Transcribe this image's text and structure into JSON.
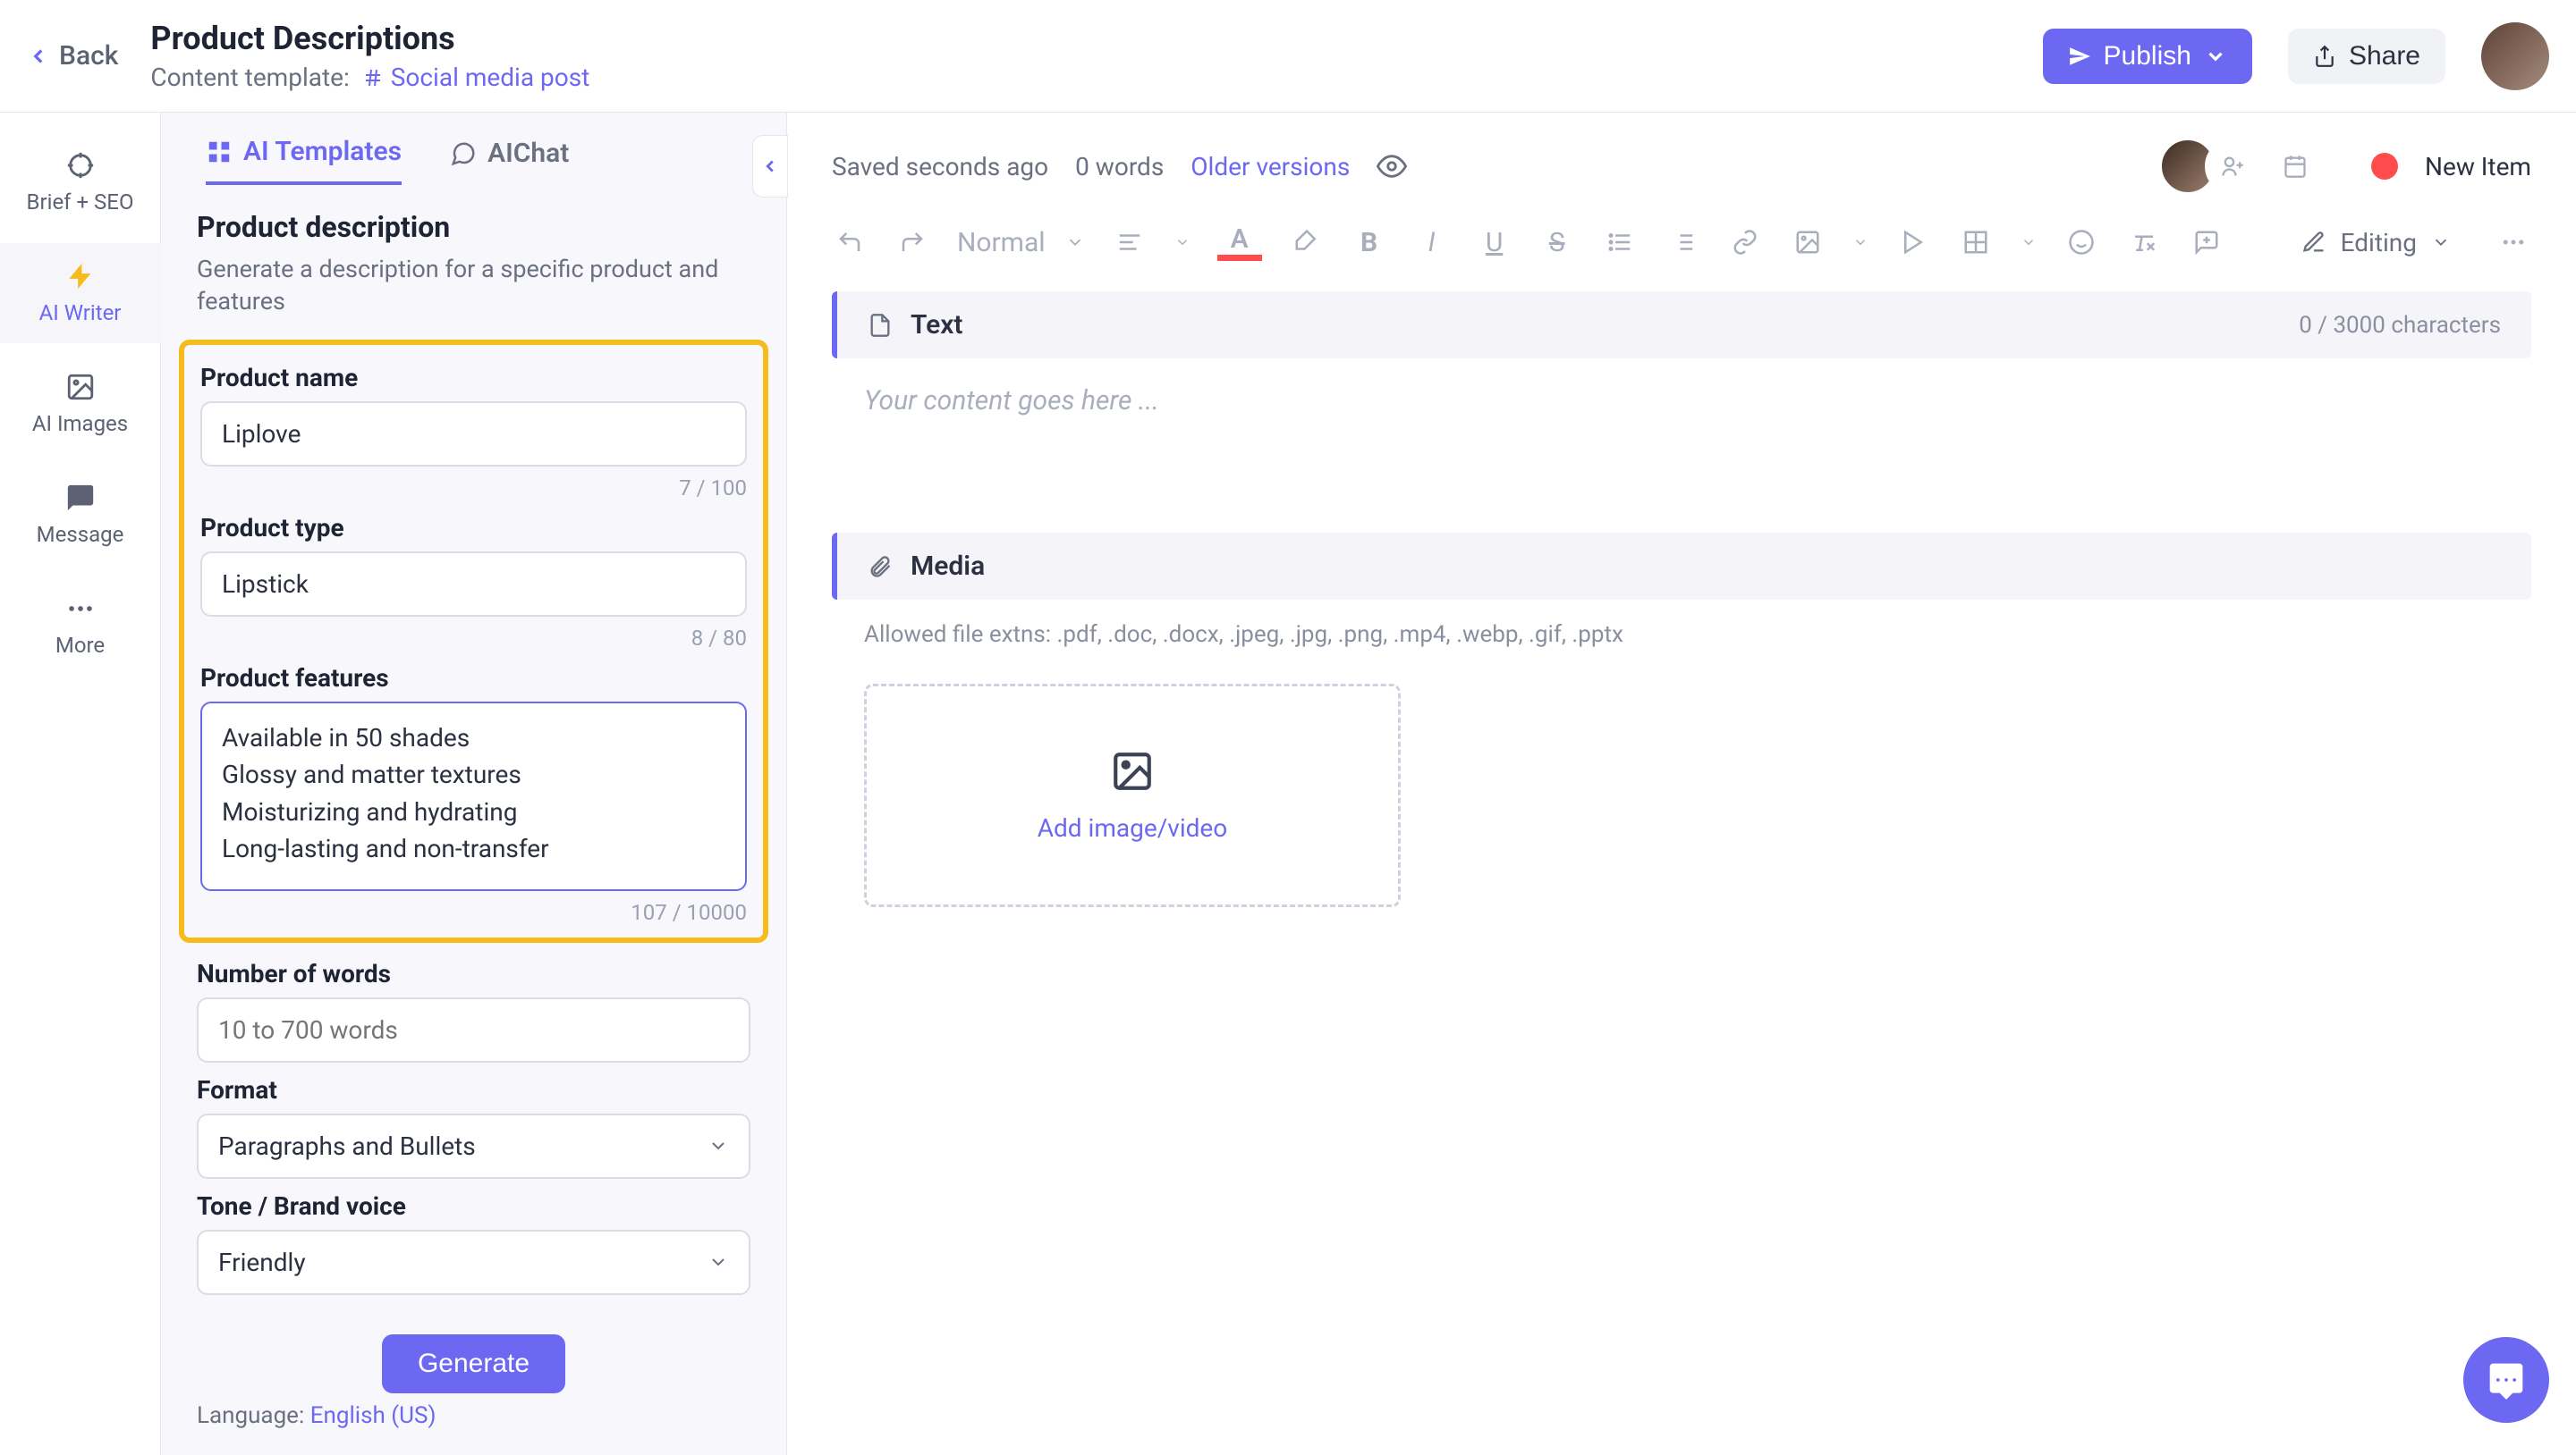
{
  "header": {
    "back": "Back",
    "title": "Product Descriptions",
    "template_label": "Content template:",
    "template_name": "Social media post",
    "publish": "Publish",
    "share": "Share"
  },
  "rail": {
    "brief": "Brief + SEO",
    "writer": "AI Writer",
    "images": "AI Images",
    "message": "Message",
    "more": "More"
  },
  "tabs": {
    "templates": "AI Templates",
    "chat": "AIChat"
  },
  "panel": {
    "title": "Product description",
    "subtitle": "Generate a description for a specific product and features",
    "name_label": "Product name",
    "name_value": "Liplove",
    "name_counter": "7 / 100",
    "type_label": "Product type",
    "type_value": "Lipstick",
    "type_counter": "8 / 80",
    "features_label": "Product features",
    "features_value": "Available in 50 shades\nGlossy and matter textures\nMoisturizing and hydrating\nLong-lasting and non-transfer",
    "features_counter": "107 / 10000",
    "words_label": "Number of words",
    "words_placeholder": "10 to 700 words",
    "format_label": "Format",
    "format_value": "Paragraphs and Bullets",
    "tone_label": "Tone / Brand voice",
    "tone_value": "Friendly",
    "generate": "Generate",
    "lang_label": "Language: ",
    "lang_value": "English (US)"
  },
  "editor": {
    "saved": "Saved seconds ago",
    "words": "0 words",
    "older": "Older versions",
    "new_item": "New Item",
    "font": "Normal",
    "mode": "Editing",
    "text_section": "Text",
    "char_counter": "0 / 3000 characters",
    "placeholder": "Your content goes here ...",
    "media_section": "Media",
    "media_hint": "Allowed file extns: .pdf, .doc, .docx, .jpeg, .jpg, .png, .mp4, .webp, .gif, .pptx",
    "upload": "Add image/video"
  }
}
